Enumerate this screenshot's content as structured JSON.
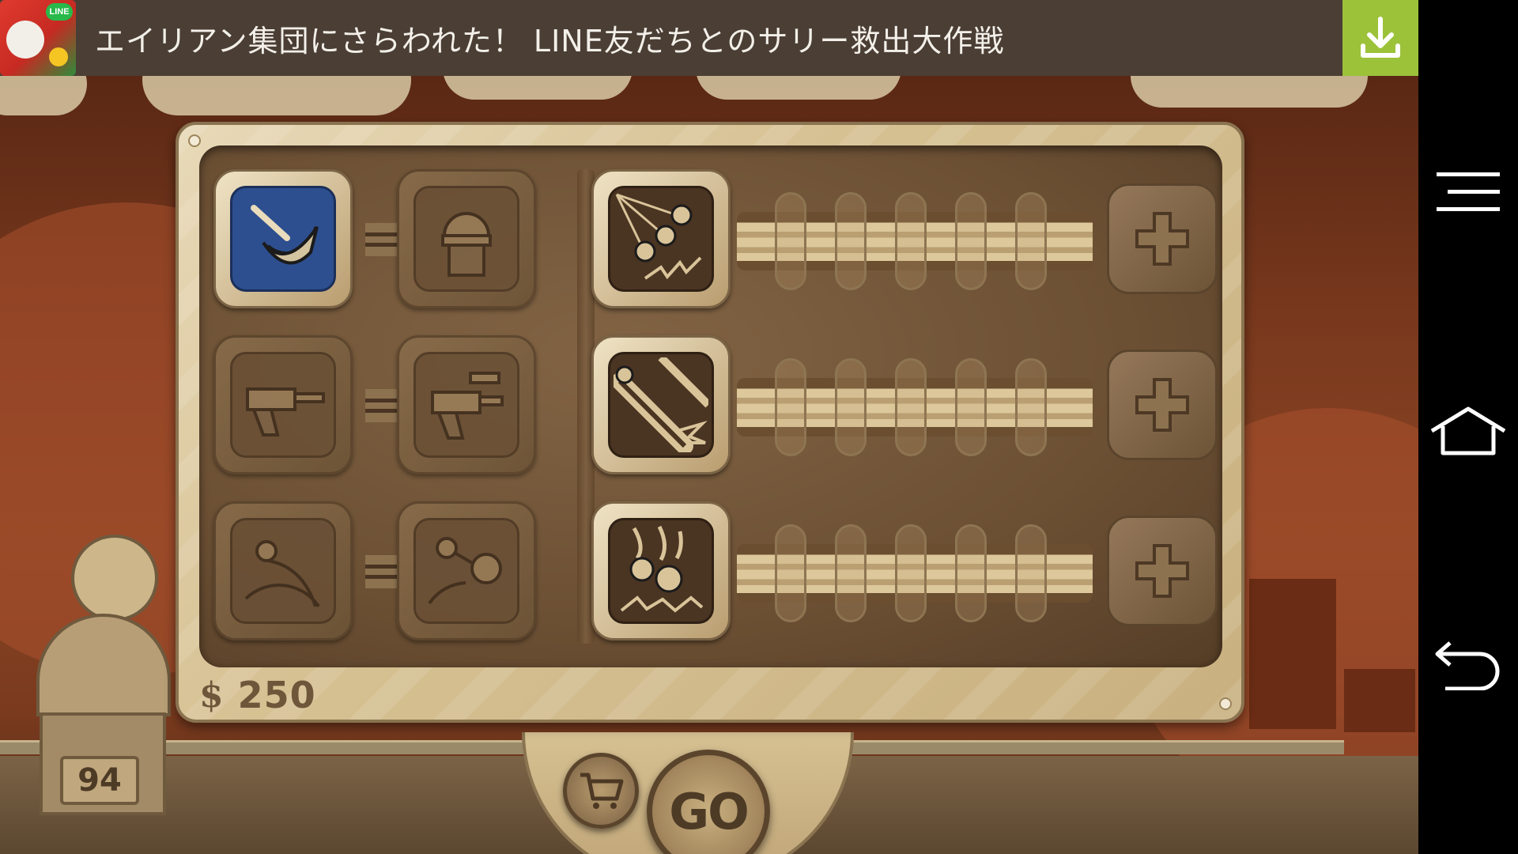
{
  "ad": {
    "text": "エイリアン集団にさらわれた！ LINE友だちとのサリー救出大作戦",
    "badge_label": "LINE",
    "icon": "app-icon",
    "download_icon": "download-icon",
    "colors": {
      "banner": "#4a3e35",
      "download": "#9cc23a"
    }
  },
  "nav": {
    "items": [
      {
        "name": "menu",
        "icon": "menu-icon"
      },
      {
        "name": "home",
        "icon": "home-icon"
      },
      {
        "name": "back",
        "icon": "back-icon"
      }
    ]
  },
  "scene": {
    "tower_level": "94"
  },
  "upgrades": {
    "tier_rows": [
      {
        "left": "dish-ability",
        "right": "bunker-ability",
        "left_state": "selected",
        "right_state": "locked"
      },
      {
        "left": "cannon-ability",
        "right": "cannon-upgrade-ability",
        "left_state": "locked",
        "right_state": "locked"
      },
      {
        "left": "orbit-ability",
        "right": "orbit-upgrade-ability",
        "left_state": "locked",
        "right_state": "locked"
      }
    ],
    "stat_rows": [
      {
        "icon": "cluster-shot-icon",
        "level": 0,
        "max": 5
      },
      {
        "icon": "laser-beam-icon",
        "level": 0,
        "max": 5
      },
      {
        "icon": "fire-ball-icon",
        "level": 0,
        "max": 5
      }
    ]
  },
  "money": {
    "symbol": "$",
    "amount": "250"
  },
  "buttons": {
    "go_label": "GO",
    "shop_icon": "cart-icon"
  }
}
